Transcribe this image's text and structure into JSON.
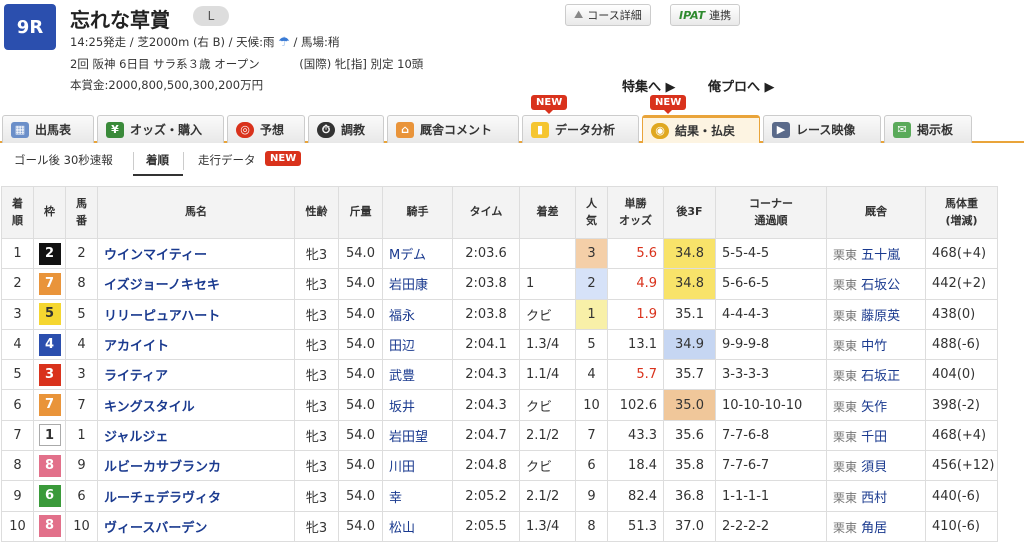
{
  "race": {
    "number": "9R",
    "title": "忘れな草賞",
    "grade": "L",
    "line1": "14:25発走 / 芝2000m (右 B) / 天候:雨",
    "going": "/ 馬場:稍",
    "line2a": "2回 阪神 6日目 サラ系３歳 オープン",
    "line2b": "(国際) 牝[指] 別定 10頭",
    "prize": "本賞金:2000,800,500,300,200万円"
  },
  "header_buttons": {
    "course": "コース詳細",
    "ipat": "IPAT",
    "ipat_suffix": "連携"
  },
  "links": {
    "special": "特集へ ▶",
    "pro": "俺プロへ ▶"
  },
  "tabs": [
    {
      "label": "出馬表",
      "icon": "table-icon"
    },
    {
      "label": "オッズ・購入",
      "icon": "odds-icon"
    },
    {
      "label": "予想",
      "icon": "target-icon"
    },
    {
      "label": "調教",
      "icon": "stopwatch-icon"
    },
    {
      "label": "厩舎コメント",
      "icon": "stable-icon"
    },
    {
      "label": "データ分析",
      "icon": "bar-chart-icon"
    },
    {
      "label": "結果・払戻",
      "icon": "coins-icon"
    },
    {
      "label": "レース映像",
      "icon": "video-icon"
    },
    {
      "label": "掲示板",
      "icon": "chat-icon"
    }
  ],
  "new_label": "NEW",
  "subtabs": {
    "early": "ゴール後 30秒速報",
    "order": "着順",
    "running": "走行データ"
  },
  "columns": [
    "着順",
    "枠",
    "馬番",
    "馬名",
    "性齢",
    "斤量",
    "騎手",
    "タイム",
    "着差",
    "人気",
    "単勝オッズ",
    "後3F",
    "コーナー通過順",
    "厩舎",
    "馬体重(増減)"
  ],
  "column_headers": {
    "rank": [
      "着",
      "順"
    ],
    "waku": "枠",
    "num": [
      "馬",
      "番"
    ],
    "name": "馬名",
    "sexage": "性齢",
    "weight": "斤量",
    "jockey": "騎手",
    "time": "タイム",
    "margin": "着差",
    "pop": [
      "人",
      "気"
    ],
    "odds": [
      "単勝",
      "オッズ"
    ],
    "last3f": "後3F",
    "corner": [
      "コーナー",
      "通過順"
    ],
    "trainer": "厩舎",
    "body": [
      "馬体重",
      "(増減)"
    ]
  },
  "rows": [
    {
      "rank": "1",
      "waku": "2",
      "num": "2",
      "name": "ウインマイティー",
      "sexage": "牝3",
      "weight": "54.0",
      "jockey": "Mデム",
      "time": "2:03.6",
      "margin": "",
      "pop": "3",
      "odds": "5.6",
      "last3f": "34.8",
      "corner": "5-5-4-5",
      "loc": "栗東",
      "trainer": "五十嵐",
      "body": "468(+4)"
    },
    {
      "rank": "2",
      "waku": "7",
      "num": "8",
      "name": "イズジョーノキセキ",
      "sexage": "牝3",
      "weight": "54.0",
      "jockey": "岩田康",
      "time": "2:03.8",
      "margin": "1",
      "pop": "2",
      "odds": "4.9",
      "last3f": "34.8",
      "corner": "5-6-6-5",
      "loc": "栗東",
      "trainer": "石坂公",
      "body": "442(+2)"
    },
    {
      "rank": "3",
      "waku": "5",
      "num": "5",
      "name": "リリーピュアハート",
      "sexage": "牝3",
      "weight": "54.0",
      "jockey": "福永",
      "time": "2:03.8",
      "margin": "クビ",
      "pop": "1",
      "odds": "1.9",
      "last3f": "35.1",
      "corner": "4-4-4-3",
      "loc": "栗東",
      "trainer": "藤原英",
      "body": "438(0)"
    },
    {
      "rank": "4",
      "waku": "4",
      "num": "4",
      "name": "アカイイト",
      "sexage": "牝3",
      "weight": "54.0",
      "jockey": "田辺",
      "time": "2:04.1",
      "margin": "1.3/4",
      "pop": "5",
      "odds": "13.1",
      "last3f": "34.9",
      "corner": "9-9-9-8",
      "loc": "栗東",
      "trainer": "中竹",
      "body": "488(-6)"
    },
    {
      "rank": "5",
      "waku": "3",
      "num": "3",
      "name": "ライティア",
      "sexage": "牝3",
      "weight": "54.0",
      "jockey": "武豊",
      "time": "2:04.3",
      "margin": "1.1/4",
      "pop": "4",
      "odds": "5.7",
      "last3f": "35.7",
      "corner": "3-3-3-3",
      "loc": "栗東",
      "trainer": "石坂正",
      "body": "404(0)"
    },
    {
      "rank": "6",
      "waku": "7",
      "num": "7",
      "name": "キングスタイル",
      "sexage": "牝3",
      "weight": "54.0",
      "jockey": "坂井",
      "time": "2:04.3",
      "margin": "クビ",
      "pop": "10",
      "odds": "102.6",
      "last3f": "35.0",
      "corner": "10-10-10-10",
      "loc": "栗東",
      "trainer": "矢作",
      "body": "398(-2)"
    },
    {
      "rank": "7",
      "waku": "1",
      "num": "1",
      "name": "ジャルジェ",
      "sexage": "牝3",
      "weight": "54.0",
      "jockey": "岩田望",
      "time": "2:04.7",
      "margin": "2.1/2",
      "pop": "7",
      "odds": "43.3",
      "last3f": "35.6",
      "corner": "7-7-6-8",
      "loc": "栗東",
      "trainer": "千田",
      "body": "468(+4)"
    },
    {
      "rank": "8",
      "waku": "8",
      "num": "9",
      "name": "ルビーカサブランカ",
      "sexage": "牝3",
      "weight": "54.0",
      "jockey": "川田",
      "time": "2:04.8",
      "margin": "クビ",
      "pop": "6",
      "odds": "18.4",
      "last3f": "35.8",
      "corner": "7-7-6-7",
      "loc": "栗東",
      "trainer": "須貝",
      "body": "456(+12)"
    },
    {
      "rank": "9",
      "waku": "6",
      "num": "6",
      "name": "ルーチェデラヴィタ",
      "sexage": "牝3",
      "weight": "54.0",
      "jockey": "幸",
      "time": "2:05.2",
      "margin": "2.1/2",
      "pop": "9",
      "odds": "82.4",
      "last3f": "36.8",
      "corner": "1-1-1-1",
      "loc": "栗東",
      "trainer": "西村",
      "body": "440(-6)"
    },
    {
      "rank": "10",
      "waku": "8",
      "num": "10",
      "name": "ヴィースバーデン",
      "sexage": "牝3",
      "weight": "54.0",
      "jockey": "松山",
      "time": "2:05.5",
      "margin": "1.3/4",
      "pop": "8",
      "odds": "51.3",
      "last3f": "37.0",
      "corner": "2-2-2-2",
      "loc": "栗東",
      "trainer": "角居",
      "body": "410(-6)"
    }
  ],
  "colors": {
    "waku": {
      "1": "#ffffff",
      "2": "#111111",
      "3": "#d9321c",
      "4": "#2b4fae",
      "5": "#f5d630",
      "6": "#3a9a3a",
      "7": "#e9943a",
      "8": "#e2708a"
    },
    "accent": "#e9a43a",
    "link": "#1a3a8f",
    "new": "#d9321c"
  }
}
